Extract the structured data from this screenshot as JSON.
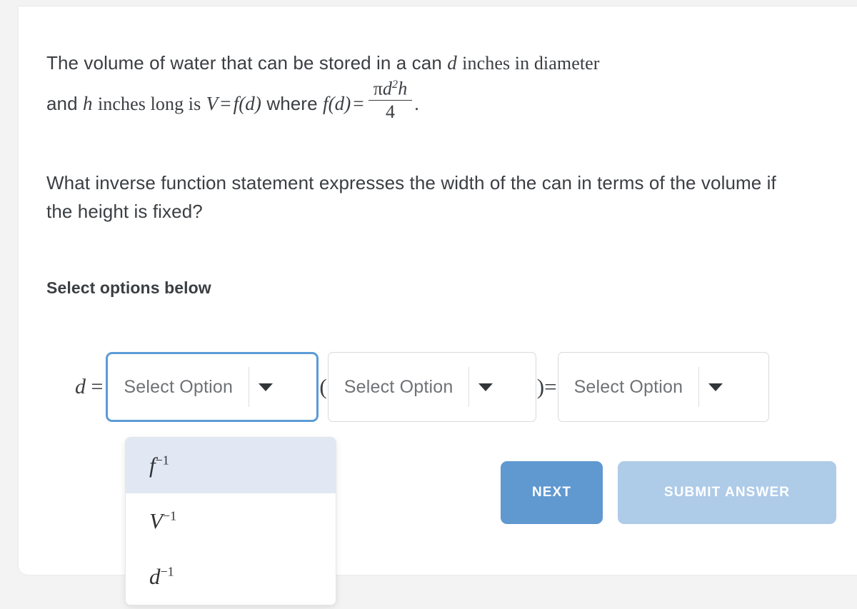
{
  "statement": {
    "line1_a": "The volume of water that can be stored in a can",
    "var_d": "d",
    "line1_b": "inches in diameter",
    "line2_a": "and",
    "var_h": "h",
    "line2_b": "inches long is",
    "var_V": "V",
    "eq1": "=",
    "fn_fd_1": "f(d)",
    "line2_c": "where",
    "fn_fd_2": "f(d)",
    "eq2": "=",
    "fraction": {
      "numerator": "πd²h",
      "num_pi": "π",
      "num_d": "d",
      "num_exp": "2",
      "num_h": "h",
      "denominator": "4"
    },
    "period": "."
  },
  "question": "What inverse function statement expresses the width of the can in terms of the volume if the height is fixed?",
  "select_heading": "Select options below",
  "equation": {
    "lhs_var": "d",
    "lhs_eq": "=",
    "open_paren": "(",
    "close_paren_eq": ")=",
    "selects": [
      {
        "id": "sel-1",
        "placeholder": "Select Option",
        "value": "",
        "focused": true,
        "caret": "chevron-down-icon"
      },
      {
        "id": "sel-2",
        "placeholder": "Select Option",
        "value": "",
        "focused": false,
        "caret": "chevron-down-icon"
      },
      {
        "id": "sel-3",
        "placeholder": "Select Option",
        "value": "",
        "focused": false,
        "caret": "chevron-down-icon"
      }
    ]
  },
  "dropdown": {
    "open": true,
    "owner": "sel-1",
    "options": [
      {
        "base": "f",
        "exp": "−1",
        "highlighted": true
      },
      {
        "base": "V",
        "exp": "−1",
        "highlighted": false
      },
      {
        "base": "d",
        "exp": "−1",
        "highlighted": false
      }
    ]
  },
  "actions": {
    "next_label": "NEXT",
    "submit_label": "SUBMIT ANSWER"
  },
  "colors": {
    "focus_border": "#5b9bd5",
    "next_button": "#6098d0",
    "submit_button": "#aecbe8",
    "option_highlight": "#e2e7f4",
    "text": "#3b3e42",
    "placeholder": "#6f7276",
    "page_background": "#f3f3f3",
    "card_background": "#ffffff"
  }
}
